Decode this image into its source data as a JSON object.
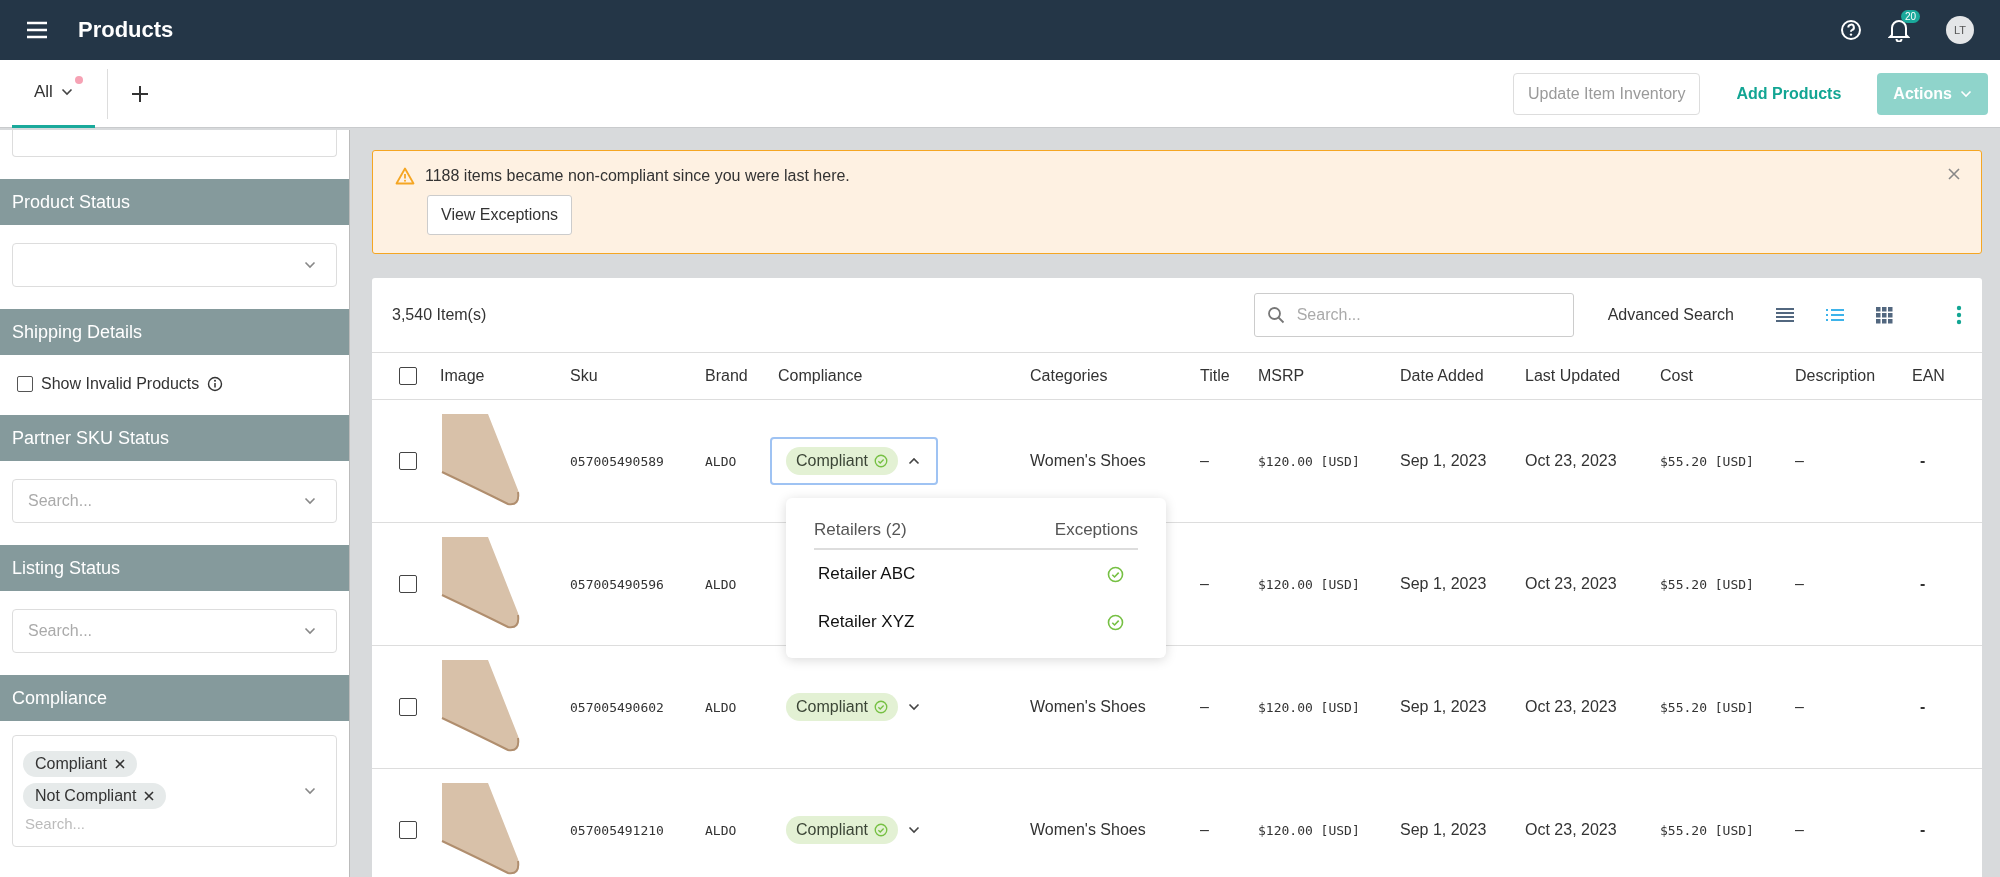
{
  "topbar": {
    "title": "Products",
    "notifications": "20",
    "avatar": "LT"
  },
  "tabs": [
    {
      "label": "All",
      "selected": true,
      "unsaved": true
    }
  ],
  "actions": [
    {
      "label": "Update Item Inventory",
      "kind": "outline",
      "disabled": true
    },
    {
      "label": "Add Products",
      "kind": "text",
      "disabled": false
    },
    {
      "label": "Actions",
      "kind": "primary",
      "disabled": true
    }
  ],
  "sidebar": {
    "sections": [
      {
        "title": "Product Status",
        "kind": "select"
      },
      {
        "title": "Shipping Details",
        "kind": "checkbox",
        "label": "Show Invalid Products",
        "checked": false
      },
      {
        "title": "Partner SKU Status",
        "kind": "select",
        "placeholder": "Search..."
      },
      {
        "title": "Listing Status",
        "kind": "select",
        "placeholder": "Search..."
      },
      {
        "title": "Compliance",
        "kind": "multiselect",
        "tags": [
          "Compliant",
          "Not Compliant"
        ],
        "placeholder": "Search..."
      }
    ]
  },
  "alert": {
    "message": "1188 items became non-compliant since you were last here.",
    "button": "View Exceptions"
  },
  "table": {
    "count": "3,540 Item(s)",
    "search_placeholder": "Search...",
    "advanced_search": "Advanced Search",
    "views": [
      {
        "kind": "compact",
        "selected": false
      },
      {
        "kind": "list",
        "selected": true
      },
      {
        "kind": "grid",
        "selected": false
      }
    ],
    "all_selected": false,
    "columns": [
      "Image",
      "Sku",
      "Brand",
      "Compliance",
      "Categories",
      "Title",
      "MSRP",
      "Date Added",
      "Last Updated",
      "Cost",
      "Description",
      "EAN"
    ],
    "rows": [
      {
        "selected": false,
        "sku": "057005490589",
        "brand": "ALDO",
        "compliance": {
          "label": "Compliant",
          "expanded": true
        },
        "categories": "Women's Shoes",
        "title": "–",
        "msrp": "$120.00 [USD]",
        "date_added": "Sep 1, 2023",
        "last_updated": "Oct 23, 2023",
        "cost": "$55.20 [USD]",
        "description": "–",
        "ean": "-"
      },
      {
        "selected": false,
        "sku": "057005490596",
        "brand": "ALDO",
        "title": "–",
        "msrp": "$120.00 [USD]",
        "date_added": "Sep 1, 2023",
        "last_updated": "Oct 23, 2023",
        "cost": "$55.20 [USD]",
        "description": "–",
        "ean": "-"
      },
      {
        "selected": false,
        "sku": "057005490602",
        "brand": "ALDO",
        "compliance": {
          "label": "Compliant",
          "expanded": false
        },
        "categories": "Women's Shoes",
        "title": "–",
        "msrp": "$120.00 [USD]",
        "date_added": "Sep 1, 2023",
        "last_updated": "Oct 23, 2023",
        "cost": "$55.20 [USD]",
        "description": "–",
        "ean": "-"
      },
      {
        "selected": false,
        "sku": "057005491210",
        "brand": "ALDO",
        "compliance": {
          "label": "Compliant",
          "expanded": false
        },
        "categories": "Women's Shoes",
        "title": "–",
        "msrp": "$120.00 [USD]",
        "date_added": "Sep 1, 2023",
        "last_updated": "Oct 23, 2023",
        "cost": "$55.20 [USD]",
        "description": "–",
        "ean": "-"
      }
    ],
    "popup": {
      "heading": "Retailers (2)",
      "column": "Exceptions",
      "retailers": [
        {
          "name": "Retailer ABC",
          "compliant": true
        },
        {
          "name": "Retailer XYZ",
          "compliant": true
        }
      ]
    }
  }
}
